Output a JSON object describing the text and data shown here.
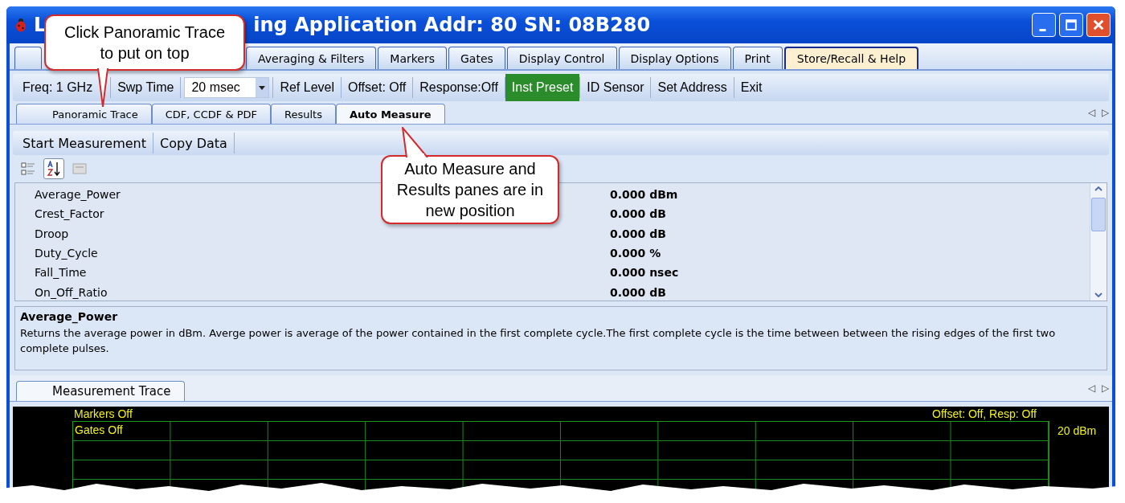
{
  "window": {
    "title_start": "L",
    "title_end": "ing Application  Addr: 80  SN: 08B280"
  },
  "top_tabs": [
    {
      "selected": false
    },
    {
      "label": "Averaging & Filters",
      "selected": false
    },
    {
      "label": "Markers",
      "selected": false
    },
    {
      "label": "Gates",
      "selected": false
    },
    {
      "label": "Display Control",
      "selected": false
    },
    {
      "label": "Display Options",
      "selected": false
    },
    {
      "label": "Print",
      "selected": false
    },
    {
      "label": "Store/Recall & Help",
      "selected": true
    }
  ],
  "toolbar": [
    {
      "kind": "button",
      "label": "Freq: 1 GHz"
    },
    {
      "kind": "button",
      "label": "Swp Time"
    },
    {
      "kind": "combo",
      "label": "20 msec"
    },
    {
      "kind": "button",
      "label": "Ref Level"
    },
    {
      "kind": "button",
      "label": "Offset: Off"
    },
    {
      "kind": "button",
      "label": "Response:Off"
    },
    {
      "kind": "highlight",
      "label": "Inst Preset"
    },
    {
      "kind": "button",
      "label": "ID Sensor"
    },
    {
      "kind": "button",
      "label": "Set Address"
    },
    {
      "kind": "button",
      "label": "Exit"
    }
  ],
  "sub_tabs": [
    {
      "label": "Panoramic Trace",
      "selected": false
    },
    {
      "label": "CDF, CCDF & PDF",
      "selected": false
    },
    {
      "label": "Results",
      "selected": false
    },
    {
      "label": "Auto Measure",
      "selected": true
    }
  ],
  "sub_tab_arrows": [
    "◁",
    "▷"
  ],
  "commands": [
    "Start Measurement",
    "Copy Data"
  ],
  "grid_tools": [
    {
      "kind": "categorized",
      "on": false
    },
    {
      "kind": "alphabetical",
      "on": true
    },
    {
      "kind": "pages",
      "on": false
    }
  ],
  "properties": [
    {
      "name": "Average_Power",
      "value": "0.000 dBm"
    },
    {
      "name": "Crest_Factor",
      "value": "0.000 dB"
    },
    {
      "name": "Droop",
      "value": "0.000 dB"
    },
    {
      "name": "Duty_Cycle",
      "value": "0.000 %"
    },
    {
      "name": "Fall_Time",
      "value": "0.000 nsec"
    },
    {
      "name": "On_Off_Ratio",
      "value": "0.000 dB"
    }
  ],
  "description": {
    "title": "Average_Power",
    "text": "Returns the average power in dBm. Averge power is average of the power contained in the first complete cycle.The first complete cycle is the time between between the rising edges of the first two complete pulses."
  },
  "trace": {
    "tab": "Measurement Trace",
    "arrows": [
      "◁",
      "▷"
    ],
    "markers": "Markers Off",
    "gates": "Gates Off",
    "offset": "Offset: Off, Resp: Off",
    "ref": "20 dBm"
  },
  "callouts": [
    {
      "text": "Click Panoramic Trace to put on top"
    },
    {
      "text": "Auto Measure and Results panes are in new position"
    }
  ]
}
